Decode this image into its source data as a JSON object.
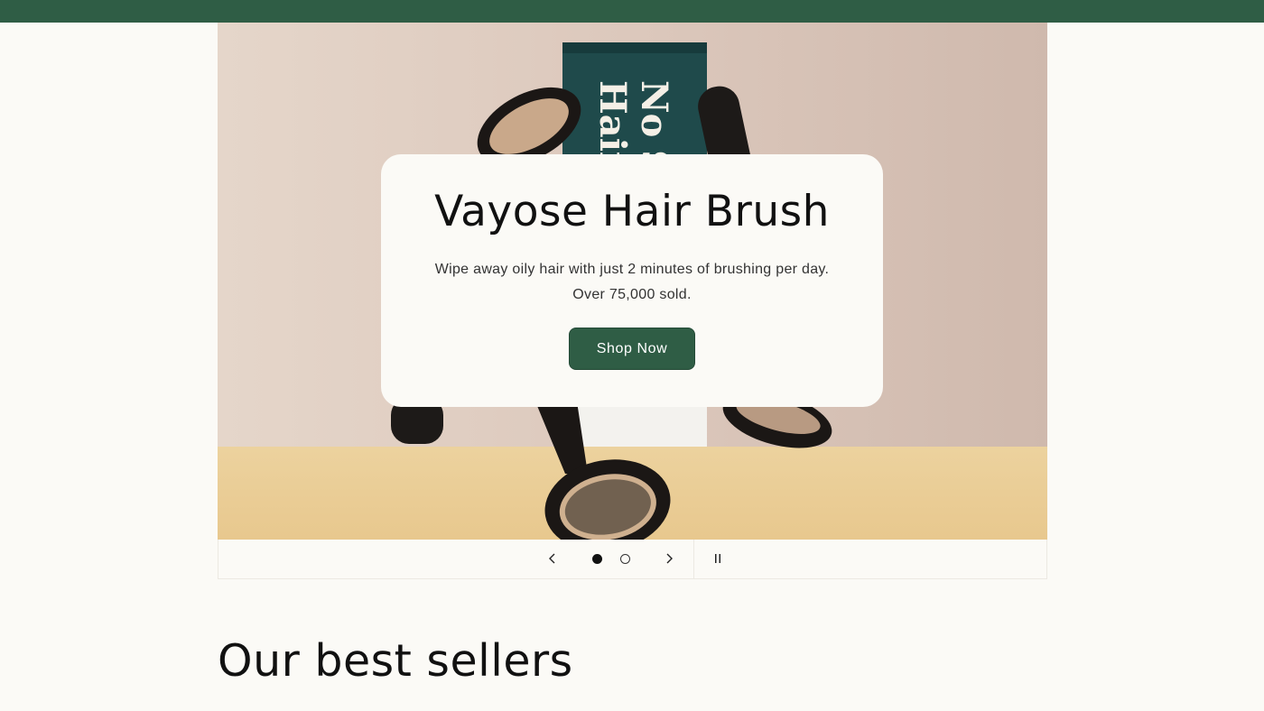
{
  "colors": {
    "brand_green": "#2f5d45",
    "page_background": "#fbfaf6",
    "hero_backdrop": "#d9c7bd",
    "hero_shelf": "#ebcf98"
  },
  "hero": {
    "title": "Vayose Hair Brush",
    "description_line1": "Wipe away oily hair with just 2 minutes of brushing per day.",
    "description_line2": "Over 75,000 sold.",
    "cta_label": "Shop Now",
    "box_text_line1": "No S",
    "box_text_line2": "Hair"
  },
  "slider": {
    "prev_icon": "chevron-left-icon",
    "next_icon": "chevron-right-icon",
    "pause_icon": "pause-icon",
    "slide_count": 2,
    "active_slide": 1
  },
  "best_sellers": {
    "title": "Our best sellers"
  }
}
